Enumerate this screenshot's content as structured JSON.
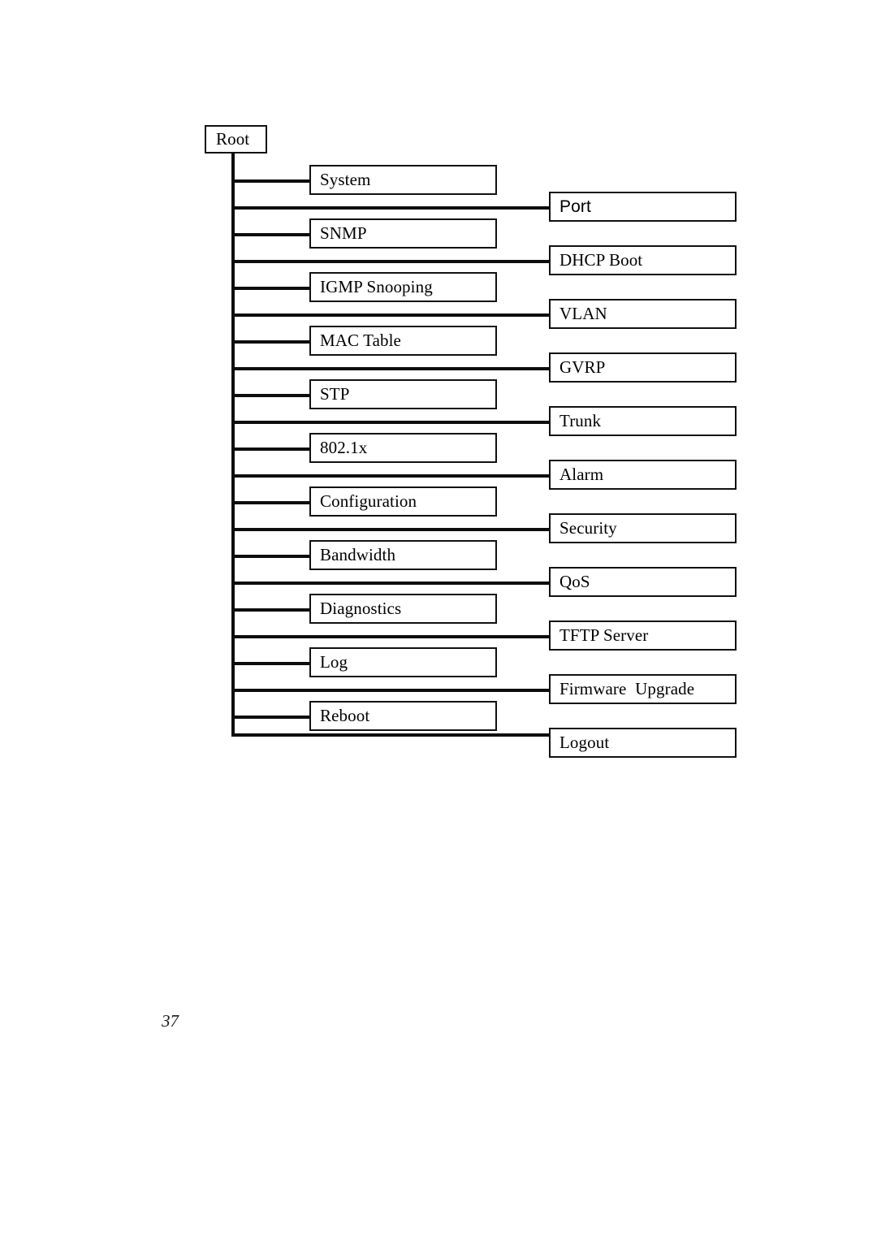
{
  "page": {
    "number": "37",
    "background": "#ffffff",
    "ink": "#0d0d0d"
  },
  "diagram": {
    "type": "tree",
    "title": "",
    "root": {
      "label": "Root"
    },
    "middle_column": [
      {
        "label": "System"
      },
      {
        "label": "SNMP"
      },
      {
        "label": "IGMP Snooping"
      },
      {
        "label": "MAC Table"
      },
      {
        "label": "STP"
      },
      {
        "label": "802.1x"
      },
      {
        "label": "Configuration"
      },
      {
        "label": "Bandwidth"
      },
      {
        "label": "Diagnostics"
      },
      {
        "label": "Log"
      },
      {
        "label": "Reboot"
      }
    ],
    "right_column": [
      {
        "label": "Port"
      },
      {
        "label": "DHCP Boot"
      },
      {
        "label": "VLAN"
      },
      {
        "label": "GVRP"
      },
      {
        "label": "Trunk"
      },
      {
        "label": "Alarm"
      },
      {
        "label": "Security"
      },
      {
        "label": "QoS"
      },
      {
        "label": "TFTP Server"
      },
      {
        "label": "Firmware  Upgrade"
      },
      {
        "label": "Logout"
      }
    ]
  }
}
